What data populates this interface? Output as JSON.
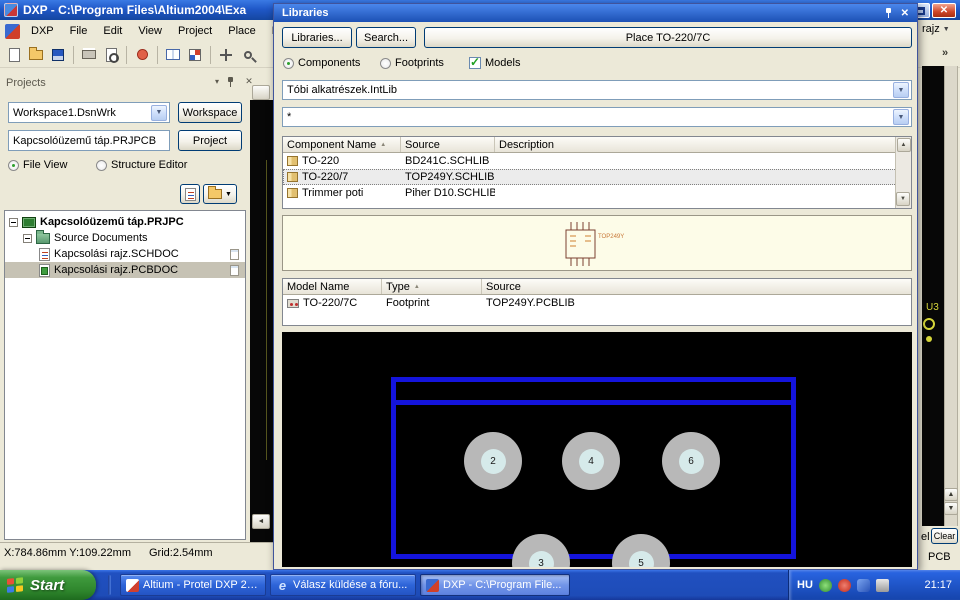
{
  "window": {
    "title": "DXP - C:\\Program Files\\Altium2004\\Exa",
    "menu_items": [
      "DXP",
      "File",
      "Edit",
      "View",
      "Project",
      "Place",
      "Des"
    ],
    "right_fragment": "rajz",
    "chevron": "»"
  },
  "projects": {
    "panel_title": "Projects",
    "workspace_value": "Workspace1.DsnWrk",
    "workspace_button": "Workspace",
    "project_value": "Kapcsolóüzemű táp.PRJPCB",
    "project_button": "Project",
    "file_view_label": "File View",
    "structure_editor_label": "Structure Editor",
    "tree_root": "Kapcsolóüzemű táp.PRJPC",
    "tree_folder": "Source Documents",
    "tree_doc_sch": "Kapcsolási rajz.SCHDOC",
    "tree_doc_pcb": "Kapcsolási rajz.PCBDOC",
    "status_position": "X:784.86mm Y:109.22mm",
    "status_grid": "Grid:2.54mm"
  },
  "libraries": {
    "panel_title": "Libraries",
    "libraries_button": "Libraries...",
    "search_button": "Search...",
    "place_button": "Place TO-220/7C",
    "components_label": "Components",
    "footprints_label": "Footprints",
    "models_label": "Models",
    "library_value": "Tóbi alkatrészek.IntLib",
    "filter_value": "*",
    "component_columns": [
      "Component Name",
      "Source",
      "Description"
    ],
    "component_rows": [
      {
        "name": "TO-220",
        "source": "BD241C.SCHLIB"
      },
      {
        "name": "TO-220/7",
        "source": "TOP249Y.SCHLIB"
      },
      {
        "name": "Trimmer poti",
        "source": "Piher D10.SCHLIB"
      }
    ],
    "symbol_label": "TOP249Y",
    "model_columns": [
      "Model Name",
      "Type",
      "Source"
    ],
    "model_rows": [
      {
        "name": "TO-220/7C",
        "type": "Footprint",
        "source": "TOP249Y.PCBLIB"
      }
    ],
    "pad_labels_top": [
      "2",
      "4",
      "6"
    ],
    "pad_labels_bottom": [
      "3",
      "5"
    ]
  },
  "pcb_edge": {
    "designator": "U3",
    "el_fragment": "el",
    "clear_button": "Clear",
    "pcb_label": "PCB"
  },
  "taskbar": {
    "start_label": "Start",
    "tasks": [
      {
        "label": "Altium - Protel DXP 20..."
      },
      {
        "label": "Válasz küldése a fóru..."
      },
      {
        "label": "DXP - C:\\Program File..."
      }
    ],
    "language_indicator": "HU",
    "clock": "21:17"
  }
}
